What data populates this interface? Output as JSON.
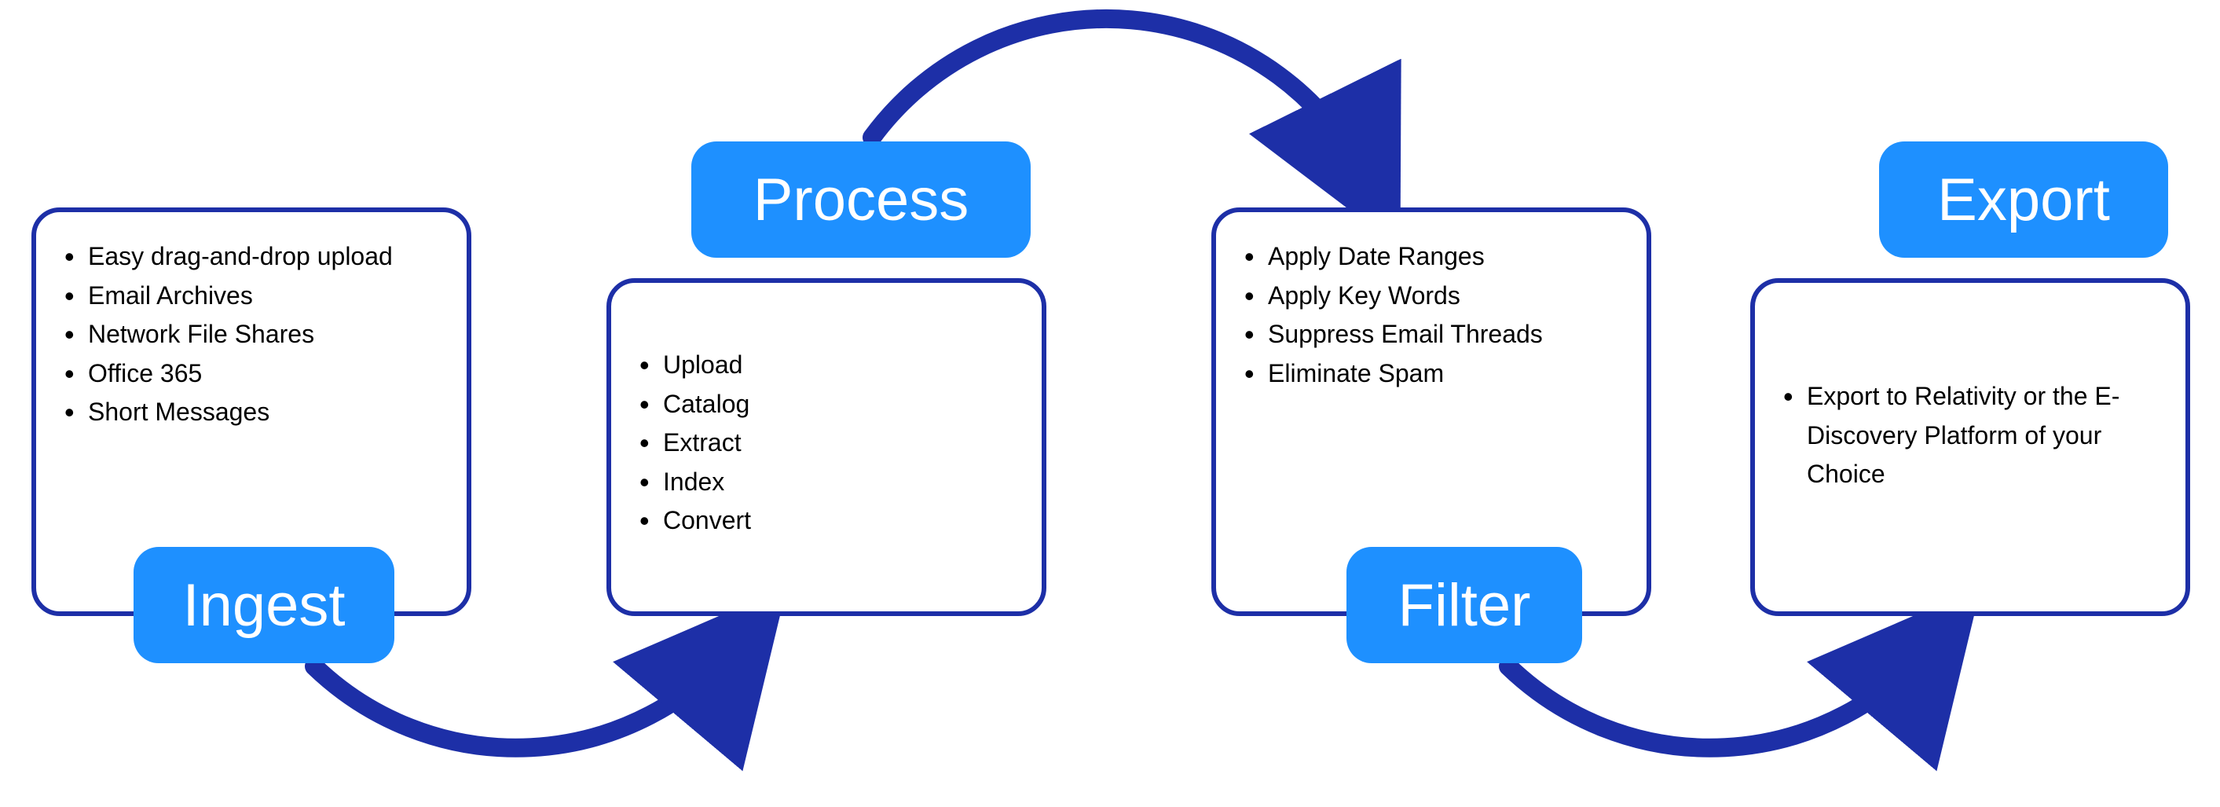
{
  "stages": [
    {
      "key": "ingest",
      "label": "Ingest",
      "items": [
        "Easy drag-and-drop upload",
        "Email Archives",
        "Network File Shares",
        "Office 365",
        "Short Messages"
      ]
    },
    {
      "key": "process",
      "label": "Process",
      "items": [
        "Upload",
        "Catalog",
        "Extract",
        "Index",
        "Convert"
      ]
    },
    {
      "key": "filter",
      "label": "Filter",
      "items": [
        "Apply Date Ranges",
        "Apply Key Words",
        "Suppress Email Threads",
        "Eliminate Spam"
      ]
    },
    {
      "key": "export",
      "label": "Export",
      "items": [
        "Export to Relativity or the E-Discovery Platform of your Choice"
      ]
    }
  ],
  "colors": {
    "pill": "#1e90ff",
    "border": "#1d2fa7",
    "arrow": "#1d2fa7"
  }
}
